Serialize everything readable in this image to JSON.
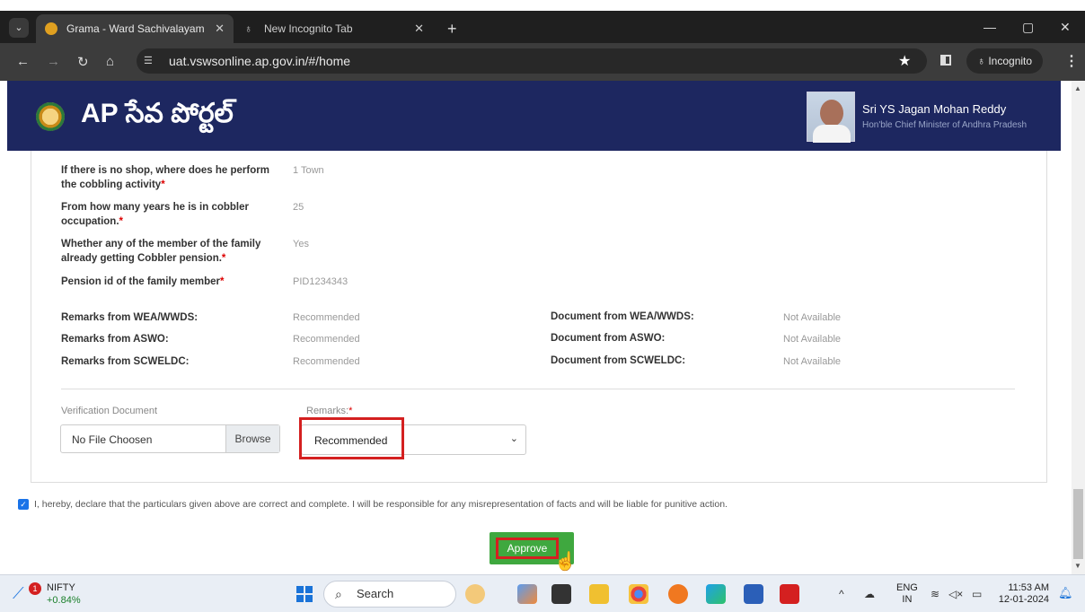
{
  "browser": {
    "tabs": [
      {
        "title": "Grama - Ward Sachivalayam",
        "active": true
      },
      {
        "title": "New Incognito Tab",
        "active": false
      }
    ],
    "url": "uat.vswsonline.ap.gov.in/#/home",
    "incognito_label": "Incognito"
  },
  "header": {
    "logo_text": "AP సేవ పోర్టల్",
    "cm_name": "Sri YS Jagan Mohan Reddy",
    "cm_title": "Hon'ble Chief Minister of Andhra Pradesh"
  },
  "form": {
    "fields": [
      {
        "label": "If there is no shop, where does he perform the cobbling activity",
        "value": "1 Town"
      },
      {
        "label": "From how many years he is in cobbler occupation.",
        "value": "25"
      },
      {
        "label": "Whether any of the member of the family already getting Cobbler pension.",
        "value": "Yes"
      },
      {
        "label": "Pension id of the family member",
        "value": "PID1234343"
      }
    ],
    "remarks_rows": [
      {
        "label": "Remarks from WEA/WWDS:",
        "value": "Recommended",
        "doc_label": "Document from WEA/WWDS:",
        "doc_value": "Not Available"
      },
      {
        "label": "Remarks from ASWO:",
        "value": "Recommended",
        "doc_label": "Document from ASWO:",
        "doc_value": "Not Available"
      },
      {
        "label": "Remarks from SCWELDC:",
        "value": "Recommended",
        "doc_label": "Document from SCWELDC:",
        "doc_value": "Not Available"
      }
    ],
    "verification_label": "Verification Document",
    "file_placeholder": "No File Choosen",
    "browse_label": "Browse",
    "remarks_label": "Remarks:",
    "remarks_selected": "Recommended",
    "declaration": "I, hereby, declare that the particulars given above are correct and complete. I will be responsible for any misrepresentation of facts and will be liable for punitive action.",
    "approve_label": "Approve"
  },
  "taskbar": {
    "widget_name": "NIFTY",
    "widget_change": "+0.84%",
    "widget_badge": "1",
    "search_placeholder": "Search",
    "lang_top": "ENG",
    "lang_bottom": "IN",
    "time": "11:53 AM",
    "date": "12-01-2024"
  }
}
